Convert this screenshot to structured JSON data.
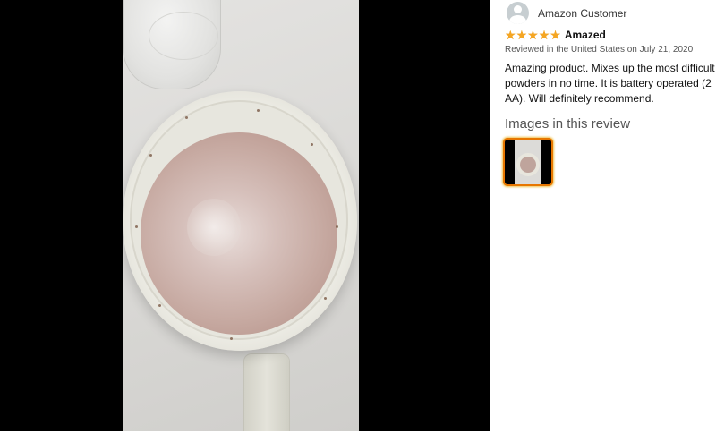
{
  "viewer": {
    "image_alt": "Customer photo of a mug with frothed chocolate drink"
  },
  "review": {
    "reviewer_name": "Amazon Customer",
    "rating_stars": 5,
    "stars": [
      "★",
      "★",
      "★",
      "★",
      "★"
    ],
    "title": "Amazed",
    "date_line": "Reviewed in the United States on July 21, 2020",
    "body": "Amazing product. Mixes up the most difficult powders in no time. It is battery operated (2 AA). Will definitely recommend.",
    "images_heading": "Images in this review"
  },
  "colors": {
    "star": "#f5a623",
    "thumb_border": "#e77600"
  },
  "icons": {
    "avatar": "user-avatar-icon",
    "star": "star-icon"
  }
}
